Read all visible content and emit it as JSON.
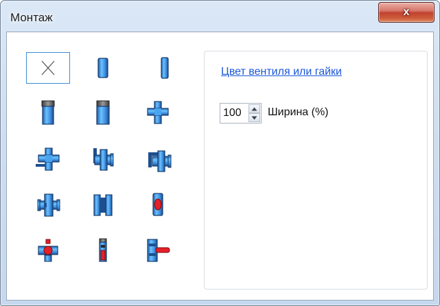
{
  "window": {
    "title": "Монтаж",
    "close_label": "x"
  },
  "panel": {
    "color_link": "Цвет вентиля или гайки",
    "width_value": "100",
    "width_label": "Ширина (%)"
  },
  "palette": {
    "selected_item": "none",
    "items": [
      "none",
      "pipe-short",
      "pipe-narrow",
      "pipe-with-cap",
      "pipe-with-cap-short",
      "tee",
      "tee-with-outlet",
      "valve-left",
      "valve-right",
      "valve-flanged",
      "coupling",
      "ball-valve",
      "ball-valve-red-handle",
      "ball-valve-vertical",
      "ball-valve-lever"
    ]
  },
  "colors": {
    "pipe_blue": "#3f9be8",
    "valve_red": "#e3202a",
    "link": "#1a56d8"
  }
}
